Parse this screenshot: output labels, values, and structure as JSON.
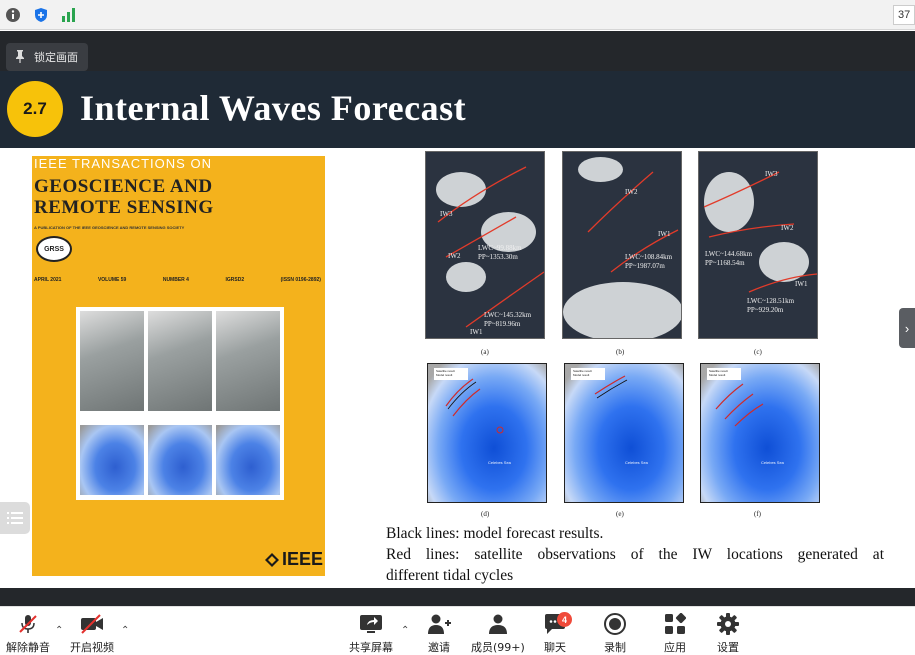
{
  "topbar": {
    "right_text": "37"
  },
  "meeting": {
    "lock_label": "锁定画面"
  },
  "slide": {
    "number": "2.7",
    "title": "Internal Waves Forecast",
    "cover": {
      "top_line": "IEEE TRANSACTIONS ON",
      "journal_name_1": "GEOSCIENCE  AND",
      "journal_name_2": "REMOTE  SENSING",
      "publication": "A PUBLICATION OF THE IEEE GEOSCIENCE AND REMOTE SENSING SOCIETY",
      "society_logo": "GRSS",
      "issue_date": "APRIL 2021",
      "volume": "VOLUME 59",
      "number": "NUMBER 4",
      "code": "IGRSD2",
      "issn": "(ISSN 0196-2892)",
      "publisher": "IEEE"
    },
    "satellite_panels": [
      {
        "id": "(a)",
        "labels": [
          "IW3",
          "IW2",
          "IW1"
        ],
        "lwc": "LWC~99.88km",
        "pp": "PP~1353.30m",
        "lwc2": "LWC~145.32km",
        "pp2": "PP~819.96m"
      },
      {
        "id": "(b)",
        "labels": [
          "IW2",
          "IW1"
        ],
        "lwc": "LWC~108.84km",
        "pp": "PP~1987.07m"
      },
      {
        "id": "(c)",
        "labels": [
          "IW3",
          "IW2",
          "IW1"
        ],
        "lwc": "LWC~144.68km",
        "pp": "PP~1168.54m",
        "lwc2": "LWC~128.51km",
        "pp2": "PP~929.20m"
      }
    ],
    "model_panels": [
      {
        "id": "(d)",
        "legend": [
          "Satellite result",
          "Model result"
        ],
        "sea": "Celebes Sea"
      },
      {
        "id": "(e)",
        "legend": [
          "Satellite result",
          "Model result"
        ],
        "sea": "Celebes Sea"
      },
      {
        "id": "(f)",
        "legend": [
          "Satellite result",
          "Model result"
        ],
        "sea": "Celebes Sea"
      }
    ],
    "notes": {
      "line1": "Black lines: model forecast results.",
      "line2": "Red lines: satellite observations of the IW locations generated at",
      "line3": "different tidal cycles"
    }
  },
  "toolbar": {
    "unmute": "解除静音",
    "start_video": "开启视频",
    "share_screen": "共享屏幕",
    "invite": "邀请",
    "members": "成员(99+)",
    "chat": "聊天",
    "chat_badge": "4",
    "record": "录制",
    "apps": "应用",
    "settings": "设置"
  },
  "colors": {
    "badge": "#f7c20a",
    "cover": "#f4b21c",
    "header": "#1f2a36",
    "alert": "#f04a3a"
  }
}
